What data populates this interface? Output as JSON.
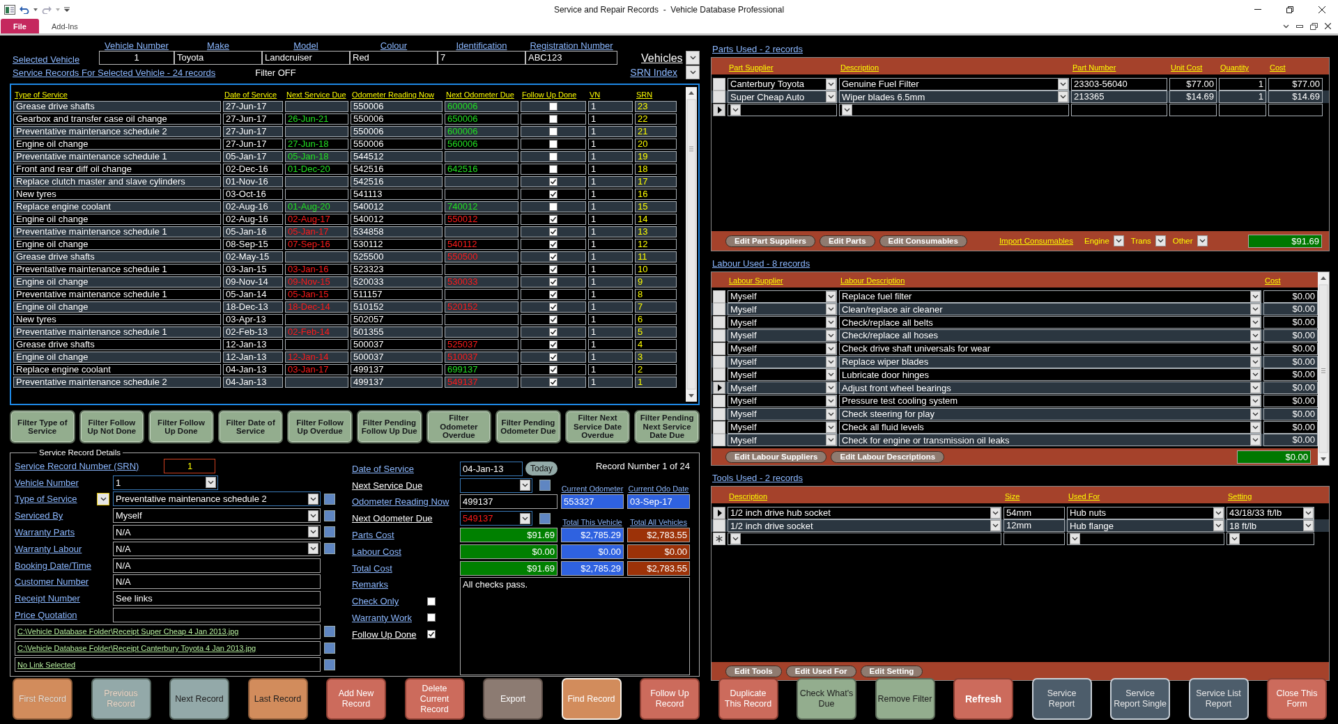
{
  "window": {
    "title": "Service and Repair Records  -  Vehicle Database Professional"
  },
  "ribbon_tabs": [
    {
      "label": "File",
      "selected": true
    },
    {
      "label": "Add-Ins",
      "selected": false
    }
  ],
  "vehicle": {
    "link": "Selected Vehicle",
    "vehicles_link": "Vehicles",
    "columns": [
      "Vehicle Number",
      "Make",
      "Model",
      "Colour",
      "Identification",
      "Registration Number"
    ],
    "values": [
      "1",
      "Toyota",
      "Landcruiser",
      "Red",
      "7",
      "ABC123"
    ]
  },
  "records_link": "Service Records For Selected Vehicle - 24 records",
  "filter_status": "Filter OFF",
  "srn_index": "SRN Index",
  "service_table": {
    "columns": [
      "Type of Service",
      "Date of Service",
      "Next Service Due",
      "Odometer Reading Now",
      "Next Odometer Due",
      "Follow Up Done",
      "VN",
      "SRN"
    ],
    "rows": [
      {
        "type": "Grease drive shafts",
        "date": "27-Jun-17",
        "odometer": "550006",
        "next_odo": "600006",
        "next_odo_overdue": false,
        "follow_up_done": false,
        "vn": "1",
        "srn": "23"
      },
      {
        "type": "Gearbox and transfer case oil change",
        "date": "27-Jun-17",
        "next_due": "26-Jun-21",
        "next_due_overdue": false,
        "odometer": "550006",
        "next_odo": "650006",
        "next_odo_overdue": false,
        "follow_up_done": false,
        "vn": "1",
        "srn": "22"
      },
      {
        "type": "Preventative maintenance schedule 2",
        "date": "27-Jun-17",
        "odometer": "550006",
        "next_odo": "600006",
        "next_odo_overdue": false,
        "follow_up_done": false,
        "vn": "1",
        "srn": "21"
      },
      {
        "type": "Engine oil change",
        "date": "27-Jun-17",
        "next_due": "27-Jun-18",
        "next_due_overdue": false,
        "odometer": "550006",
        "next_odo": "560006",
        "next_odo_overdue": false,
        "follow_up_done": false,
        "vn": "1",
        "srn": "20"
      },
      {
        "type": "Preventative maintenance schedule 1",
        "date": "05-Jan-17",
        "next_due": "05-Jan-18",
        "next_due_overdue": false,
        "odometer": "544512",
        "follow_up_done": false,
        "vn": "1",
        "srn": "19"
      },
      {
        "type": "Front and rear diff oil change",
        "date": "02-Dec-16",
        "next_due": "01-Dec-20",
        "next_due_overdue": false,
        "odometer": "542516",
        "next_odo": "642516",
        "next_odo_overdue": false,
        "follow_up_done": false,
        "vn": "1",
        "srn": "18"
      },
      {
        "type": "Replace clutch master and slave cylinders",
        "date": "01-Nov-16",
        "odometer": "542516",
        "follow_up_done": true,
        "vn": "1",
        "srn": "17"
      },
      {
        "type": "New tyres",
        "date": "03-Oct-16",
        "odometer": "541113",
        "follow_up_done": true,
        "vn": "1",
        "srn": "16"
      },
      {
        "type": "Replace engine coolant",
        "date": "02-Aug-16",
        "next_due": "01-Aug-20",
        "next_due_overdue": false,
        "odometer": "540012",
        "next_odo": "740012",
        "next_odo_overdue": false,
        "follow_up_done": false,
        "vn": "1",
        "srn": "15"
      },
      {
        "type": "Engine oil change",
        "date": "02-Aug-16",
        "next_due": "02-Aug-17",
        "next_due_overdue": true,
        "odometer": "540012",
        "next_odo": "550012",
        "next_odo_overdue": true,
        "follow_up_done": true,
        "vn": "1",
        "srn": "14"
      },
      {
        "type": "Preventative maintenance schedule 1",
        "date": "05-Jan-16",
        "next_due": "05-Jan-17",
        "next_due_overdue": true,
        "odometer": "534858",
        "follow_up_done": true,
        "vn": "1",
        "srn": "13"
      },
      {
        "type": "Engine oil change",
        "date": "08-Sep-15",
        "next_due": "07-Sep-16",
        "next_due_overdue": true,
        "odometer": "530112",
        "next_odo": "540112",
        "next_odo_overdue": true,
        "follow_up_done": true,
        "vn": "1",
        "srn": "12"
      },
      {
        "type": "Grease drive shafts",
        "date": "02-May-15",
        "odometer": "525500",
        "next_odo": "550500",
        "next_odo_overdue": true,
        "follow_up_done": true,
        "vn": "1",
        "srn": "11"
      },
      {
        "type": "Preventative maintenance schedule 1",
        "date": "03-Jan-15",
        "next_due": "03-Jan-16",
        "next_due_overdue": true,
        "odometer": "523323",
        "follow_up_done": true,
        "vn": "1",
        "srn": "10"
      },
      {
        "type": "Engine oil change",
        "date": "09-Nov-14",
        "next_due": "09-Nov-15",
        "next_due_overdue": true,
        "odometer": "520033",
        "next_odo": "530033",
        "next_odo_overdue": true,
        "follow_up_done": true,
        "vn": "1",
        "srn": "9"
      },
      {
        "type": "Preventative maintenance schedule 1",
        "date": "05-Jan-14",
        "next_due": "05-Jan-15",
        "next_due_overdue": true,
        "odometer": "511157",
        "follow_up_done": true,
        "vn": "1",
        "srn": "8"
      },
      {
        "type": "Engine oil change",
        "date": "18-Dec-13",
        "next_due": "18-Dec-14",
        "next_due_overdue": true,
        "odometer": "510152",
        "next_odo": "520152",
        "next_odo_overdue": true,
        "follow_up_done": true,
        "vn": "1",
        "srn": "7"
      },
      {
        "type": "New tyres",
        "date": "03-Apr-13",
        "odometer": "502057",
        "follow_up_done": true,
        "vn": "1",
        "srn": "6"
      },
      {
        "type": "Preventative maintenance schedule 1",
        "date": "02-Feb-13",
        "next_due": "02-Feb-14",
        "next_due_overdue": true,
        "odometer": "501355",
        "follow_up_done": true,
        "vn": "1",
        "srn": "5"
      },
      {
        "type": "Grease drive shafts",
        "date": "12-Jan-13",
        "odometer": "500037",
        "next_odo": "525037",
        "next_odo_overdue": true,
        "follow_up_done": true,
        "vn": "1",
        "srn": "4"
      },
      {
        "type": "Engine oil change",
        "date": "12-Jan-13",
        "next_due": "12-Jan-14",
        "next_due_overdue": true,
        "odometer": "500037",
        "next_odo": "510037",
        "next_odo_overdue": true,
        "follow_up_done": true,
        "vn": "1",
        "srn": "3"
      },
      {
        "type": "Replace engine coolant",
        "date": "04-Jan-13",
        "next_due": "03-Jan-17",
        "next_due_overdue": true,
        "odometer": "499137",
        "next_odo": "699137",
        "next_odo_overdue": false,
        "follow_up_done": true,
        "vn": "1",
        "srn": "2"
      },
      {
        "type": "Preventative maintenance schedule 2",
        "date": "04-Jan-13",
        "odometer": "499137",
        "next_odo": "549137",
        "next_odo_overdue": true,
        "follow_up_done": true,
        "vn": "1",
        "srn": "1"
      }
    ]
  },
  "filter_buttons": [
    "Filter Type of Service",
    "Filter Follow Up Not Done",
    "Filter Follow Up Done",
    "Filter Date of Service",
    "Filter Follow Up Overdue",
    "Filter Pending Follow Up Due",
    "Filter Odometer Overdue",
    "Filter Pending Odometer Due",
    "Filter Next Service Date Overdue",
    "Filter Pending Next Service Date Due"
  ],
  "details": {
    "legend": "Service Record Details",
    "fields": [
      {
        "kind": "number",
        "label": "Service Record Number (SRN)",
        "value": "1"
      },
      {
        "kind": "short_combo",
        "label": "Vehicle Number",
        "value": "1"
      },
      {
        "kind": "combo",
        "label": "Type of Service",
        "value": "Preventative maintenance schedule 2",
        "prefix_button": true
      },
      {
        "kind": "combo",
        "label": "Serviced By",
        "value": "Myself",
        "prefix_button": false
      },
      {
        "kind": "combo",
        "label": "Warranty Parts",
        "value": "N/A",
        "prefix_button": false
      },
      {
        "kind": "combo",
        "label": "Warranty Labour",
        "value": "N/A",
        "prefix_button": false
      },
      {
        "kind": "text",
        "label": "Booking Date/Time",
        "value": "N/A"
      },
      {
        "kind": "text",
        "label": "Customer Number",
        "value": "N/A"
      },
      {
        "kind": "text",
        "label": "Receipt Number",
        "value": "See links"
      },
      {
        "kind": "text",
        "label": "Price Quotation"
      }
    ],
    "links": [
      "C:\\Vehicle Database Folder\\Receipt Super Cheap 4 Jan 2013.jpg",
      "C:\\Vehicle Database Folder\\Receipt Canterbury Toyota 4 Jan 2013.jpg",
      "No Link Selected"
    ],
    "record_position": "Record Number 1 of 24",
    "date_of_service": {
      "label": "Date of Service",
      "value": "04-Jan-13",
      "button": "Today"
    },
    "next_service_due": {
      "label": "Next Service Due"
    },
    "odometer_now": {
      "label": "Odometer Reading Now",
      "value": "499137"
    },
    "next_odometer_due": {
      "label": "Next Odometer Due",
      "value": "549137",
      "overdue": true
    },
    "current_odometer": {
      "label": "Current Odometer",
      "value": "553327"
    },
    "current_odo_date": {
      "label": "Current Odo Date",
      "value": "03-Sep-17"
    },
    "totals_headings": [
      "Total This Vehicle",
      "Total All Vehicles"
    ],
    "costs": [
      {
        "label": "Parts Cost",
        "record": "$91.69",
        "vehicle": "$2,785.29",
        "all": "$2,783.55"
      },
      {
        "label": "Labour Cost",
        "record": "$0.00",
        "vehicle": "$0.00",
        "all": "$0.00"
      },
      {
        "label": "Total Cost",
        "record": "$91.69",
        "vehicle": "$2,785.29",
        "all": "$2,783.55"
      }
    ],
    "remarks": {
      "label": "Remarks",
      "value": "All checks pass."
    },
    "flags": [
      {
        "label": "Check Only",
        "linked": true,
        "checked": false
      },
      {
        "label": "Warranty Work",
        "linked": true,
        "checked": false
      },
      {
        "label": "Follow Up Done",
        "linked": false,
        "checked": true
      }
    ]
  },
  "parts": {
    "title": "Parts Used - 2 records",
    "columns": [
      "Part Supplier",
      "Description",
      "Part Number",
      "Unit Cost",
      "Quantity",
      "Cost"
    ],
    "rows": [
      {
        "kind": "record",
        "current": false,
        "supplier": "Canterbury Toyota",
        "description": "Genuine Fuel Filter",
        "part_number": "23303-56040",
        "unit_cost": "$77.00",
        "quantity": "1",
        "cost": "$77.00"
      },
      {
        "kind": "record",
        "current": false,
        "supplier": "Super Cheap Auto",
        "description": "Wiper blades 6.5mm",
        "part_number": "213365",
        "unit_cost": "$14.69",
        "quantity": "1",
        "cost": "$14.69"
      },
      {
        "kind": "new",
        "current": true
      }
    ],
    "buttons": [
      "Edit Part Suppliers",
      "Edit Parts",
      "Edit Consumables"
    ],
    "import_link": "Import Consumables",
    "filters": [
      "Engine",
      "Trans",
      "Other"
    ],
    "total": "$91.69"
  },
  "labour": {
    "title": "Labour Used - 8 records",
    "columns": [
      "Labour Supplier",
      "Labour Description",
      "Cost"
    ],
    "rows": [
      {
        "current": false,
        "supplier": "Myself",
        "description": "Replace fuel filter",
        "cost": "$0.00"
      },
      {
        "current": false,
        "supplier": "Myself",
        "description": "Clean/replace air cleaner",
        "cost": "$0.00"
      },
      {
        "current": false,
        "supplier": "Myself",
        "description": "Check/replace all belts",
        "cost": "$0.00"
      },
      {
        "current": false,
        "supplier": "Myself",
        "description": "Check/replace all hoses",
        "cost": "$0.00"
      },
      {
        "current": false,
        "supplier": "Myself",
        "description": "Check drive shaft universals for wear",
        "cost": "$0.00"
      },
      {
        "current": false,
        "supplier": "Myself",
        "description": "Replace wiper blades",
        "cost": "$0.00"
      },
      {
        "current": false,
        "supplier": "Myself",
        "description": "Lubricate door hinges",
        "cost": "$0.00"
      },
      {
        "current": true,
        "supplier": "Myself",
        "description": "Adjust front wheel bearings",
        "cost": "$0.00"
      },
      {
        "current": false,
        "supplier": "Myself",
        "description": "Pressure test cooling system",
        "cost": "$0.00"
      },
      {
        "current": false,
        "supplier": "Myself",
        "description": "Check steering for play",
        "cost": "$0.00"
      },
      {
        "current": false,
        "supplier": "Myself",
        "description": "Check all fluid levels",
        "cost": "$0.00"
      },
      {
        "current": false,
        "supplier": "Myself",
        "description": "Check for engine or transmission oil leaks",
        "cost": "$0.00"
      }
    ],
    "buttons": [
      "Edit Labour Suppliers",
      "Edit Labour Descriptions"
    ],
    "total": "$0.00"
  },
  "tools": {
    "title": "Tools Used - 2 records",
    "columns": [
      "Description",
      "Size",
      "Used For",
      "Setting"
    ],
    "rows": [
      {
        "kind": "record",
        "current": true,
        "description": "1/2 inch drive hub socket",
        "size": "54mm",
        "used_for": "Hub nuts",
        "setting": "43/18/33 ft/lb"
      },
      {
        "kind": "record",
        "current": false,
        "description": "1/2 inch drive socket",
        "size": "12mm",
        "used_for": "Hub flange",
        "setting": "18 ft/lb"
      },
      {
        "kind": "new",
        "current": false
      }
    ],
    "buttons": [
      "Edit Tools",
      "Edit Used For",
      "Edit Setting"
    ]
  },
  "bottom_buttons": [
    {
      "label": "First Record",
      "kind": "orange",
      "disabled": true,
      "focused": false,
      "default": false
    },
    {
      "label": "Previous Record",
      "kind": "teal",
      "disabled": true,
      "focused": false,
      "default": false
    },
    {
      "label": "Next Record",
      "kind": "teal",
      "disabled": false,
      "focused": false,
      "default": false
    },
    {
      "label": "Last Record",
      "kind": "orange",
      "disabled": false,
      "focused": false,
      "default": false
    },
    {
      "label": "Add New Record",
      "kind": "salmon",
      "disabled": false,
      "focused": false,
      "default": false
    },
    {
      "label": "Delete Current Record",
      "kind": "salmon",
      "disabled": false,
      "focused": false,
      "default": false
    },
    {
      "label": "Export",
      "kind": "taupe",
      "disabled": false,
      "focused": false,
      "default": false
    },
    {
      "label": "Find Record",
      "kind": "orange",
      "disabled": false,
      "focused": true,
      "default": false
    },
    {
      "label": "Follow Up Record",
      "kind": "salmon",
      "disabled": false,
      "focused": false,
      "default": false
    },
    {
      "label": "Duplicate This Record",
      "kind": "salmon",
      "disabled": false,
      "focused": false,
      "default": false
    },
    {
      "label": "Check What's Due",
      "kind": "sage",
      "disabled": false,
      "focused": false,
      "default": false
    },
    {
      "label": "Remove Filter",
      "kind": "sage",
      "disabled": false,
      "focused": false,
      "default": false
    },
    {
      "label": "Refresh",
      "kind": "salmon",
      "disabled": false,
      "focused": false,
      "default": true
    },
    {
      "label": "Service Report",
      "kind": "slate",
      "disabled": false,
      "focused": false,
      "default": false
    },
    {
      "label": "Service Report Single",
      "kind": "slate",
      "disabled": false,
      "focused": false,
      "default": false
    },
    {
      "label": "Service List Report",
      "kind": "slate",
      "disabled": false,
      "focused": false,
      "default": false
    },
    {
      "label": "Close This Form",
      "kind": "salmon",
      "disabled": false,
      "focused": false,
      "default": false
    }
  ]
}
